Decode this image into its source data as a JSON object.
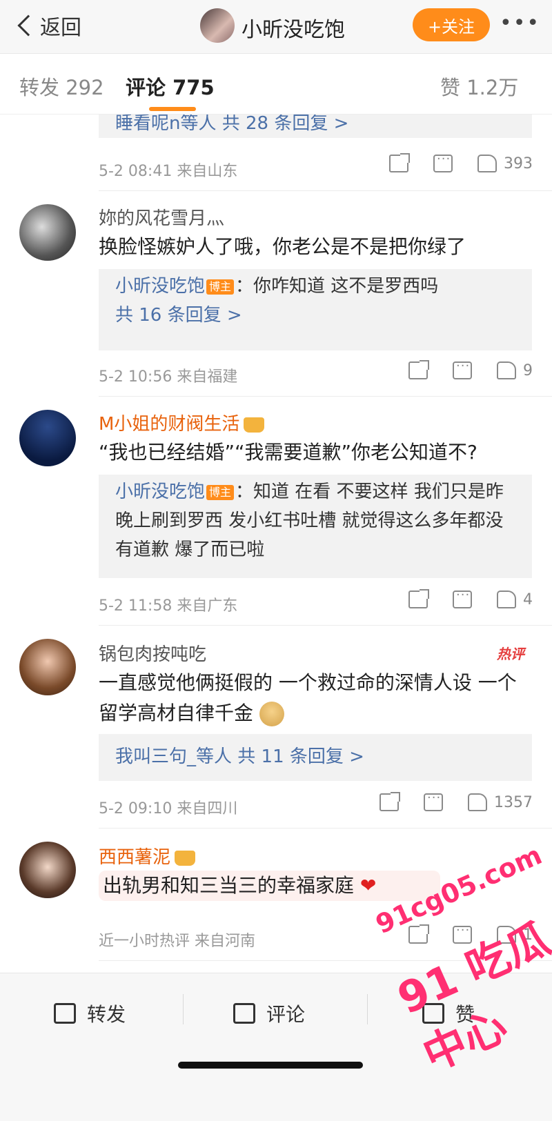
{
  "header": {
    "back_label": "返回",
    "title": "小昕没吃饱",
    "follow_label": "+关注",
    "more_label": "•••"
  },
  "tabs": {
    "repost": "转发 292",
    "comment": "评论 775",
    "like": "赞 1.2万"
  },
  "comments": [
    {
      "reply_summary_users": "睡看呢n等人",
      "reply_summary_count": "共 28 条回复 >",
      "meta": "5-2 08:41 来自山东",
      "likes": "393"
    },
    {
      "name": "妳的风花雪月灬",
      "text": "换脸怪嫉妒人了哦，你老公是不是把你绿了",
      "reply_author": "小昕没吃饱",
      "reply_badge": "博主",
      "reply_text": "：你咋知道 这不是罗西吗",
      "reply_count": "共 16 条回复 >",
      "meta": "5-2 10:56 来自福建",
      "likes": "9"
    },
    {
      "name": "M小姐的财阀生活",
      "text": "“我也已经结婚”“我需要道歉”你老公知道不?",
      "reply_author": "小昕没吃饱",
      "reply_badge": "博主",
      "reply_text": "：知道 在看 不要这样 我们只是昨晚上刷到罗西 发小红书吐槽 就觉得这么多年都没有道歉 爆了而已啦",
      "meta": "5-2 11:58 来自广东",
      "likes": "4"
    },
    {
      "name": "锅包肉按吨吃",
      "hot_label": "热评",
      "text": "一直感觉他俩挺假的 一个救过命的深情人设 一个留学高材自律千金",
      "reply_summary_users": "我叫三句_等人",
      "reply_summary_count": "共 11 条回复 >",
      "meta": "5-2 09:10 来自四川",
      "likes": "1357"
    },
    {
      "name": "西西薯泥",
      "text": "出轨男和知三当三的幸福家庭",
      "meta": "近一小时热评 来自河南",
      "likes": "1"
    }
  ],
  "bottom_bar": {
    "repost": "转发",
    "comment": "评论",
    "like": "赞"
  },
  "watermark": {
    "url": "91cg05.com",
    "name": "91 吃瓜中心"
  },
  "colors": {
    "accent": "#ff8c1a",
    "link_blue": "#4b70a8",
    "vip_orange": "#e8620c",
    "watermark_pink": "#ff2f72"
  }
}
